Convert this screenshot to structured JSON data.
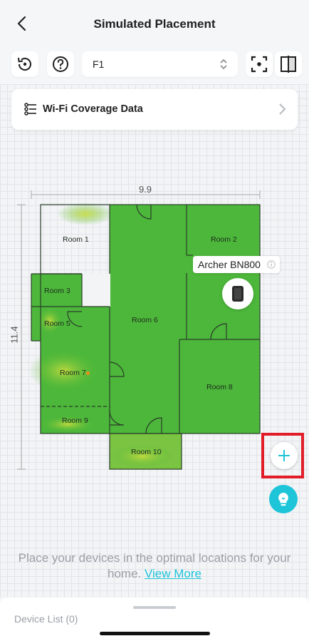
{
  "header": {
    "title": "Simulated Placement"
  },
  "toolbar": {
    "floor": "F1"
  },
  "coverage_card": {
    "label": "Wi-Fi Coverage Data"
  },
  "floorplan": {
    "width_label": "9.9",
    "height_label": "11.4",
    "rooms": [
      "Room 1",
      "Room 2",
      "Room 3",
      "Room 5",
      "Room 6",
      "Room 7",
      "Room 8",
      "Room 9",
      "Room 10"
    ]
  },
  "device": {
    "name": "Archer BN800"
  },
  "hint": {
    "text": "Place your devices in the optimal locations for your home.",
    "link": "View More"
  },
  "bottom_sheet": {
    "label": "Device List (0)"
  },
  "colors": {
    "accent": "#1ec4d8",
    "highlight": "#e11d2a",
    "coverage": "#4fb83a"
  }
}
